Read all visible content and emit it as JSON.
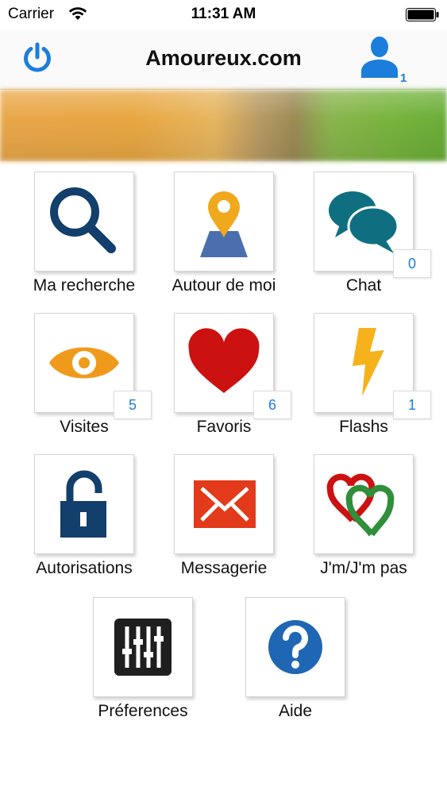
{
  "status_bar": {
    "carrier": "Carrier",
    "time": "11:31 AM"
  },
  "nav": {
    "title": "Amoureux.com",
    "profile_badge": "1"
  },
  "tiles": [
    {
      "label": "Ma recherche",
      "icon": "search-icon"
    },
    {
      "label": "Autour de moi",
      "icon": "map-pin-icon"
    },
    {
      "label": "Chat",
      "icon": "chat-bubbles-icon",
      "badge": "0"
    },
    {
      "label": "Visites",
      "icon": "eye-icon",
      "badge": "5"
    },
    {
      "label": "Favoris",
      "icon": "heart-icon",
      "badge": "6"
    },
    {
      "label": "Flashs",
      "icon": "lightning-icon",
      "badge": "1"
    },
    {
      "label": "Autorisations",
      "icon": "padlock-icon"
    },
    {
      "label": "Messagerie",
      "icon": "envelope-icon"
    },
    {
      "label": "J'm/J'm pas",
      "icon": "double-heart-icon"
    },
    {
      "label": "Préferences",
      "icon": "sliders-icon"
    },
    {
      "label": "Aide",
      "icon": "help-icon"
    }
  ],
  "colors": {
    "accent_blue": "#1b7ddc",
    "navy": "#123f6b",
    "teal": "#0f6f80",
    "orange": "#f09a1c",
    "red": "#cc1111",
    "envelope_red": "#e23a1a",
    "green": "#2f8f3a"
  }
}
